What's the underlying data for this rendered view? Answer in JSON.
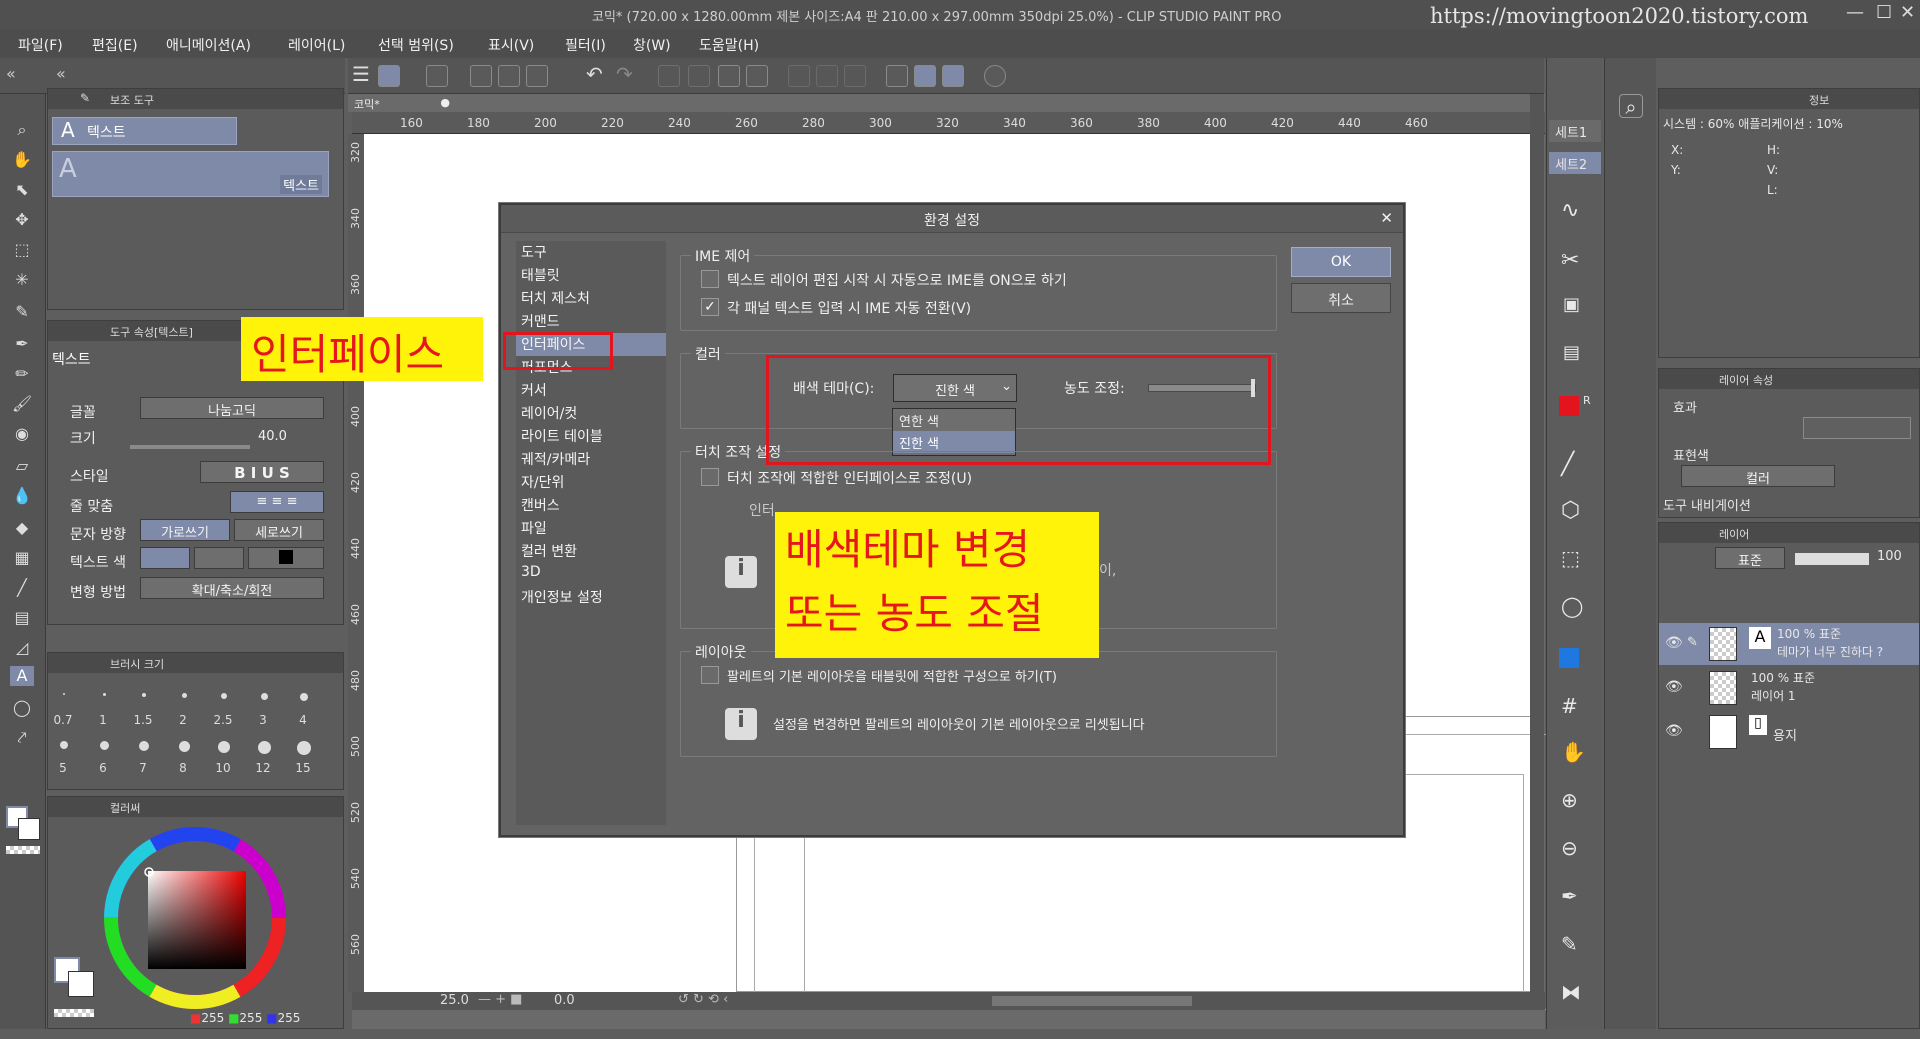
{
  "titlebar": {
    "text": "코믹* (720.00 x 1280.00mm 제본 사이즈:A4 판 210.00 x 297.00mm 350dpi 25.0%)  - CLIP STUDIO PAINT PRO",
    "url": "https://movingtoon2020.tistory.com",
    "minimize": "—",
    "maximize": "☐",
    "close": "✕"
  },
  "menu": [
    "파일(F)",
    "편집(E)",
    "애니메이션(A)",
    "레이어(L)",
    "선택 범위(S)",
    "표시(V)",
    "필터(I)",
    "창(W)",
    "도움말(H)"
  ],
  "sub_tool": {
    "title": "보조 도구",
    "item": "텍스트",
    "preview_label": "텍스트"
  },
  "tool_props": {
    "title": "도구 속성[텍스트]",
    "name": "텍스트",
    "rows": [
      {
        "label": "글꼴",
        "value": "나눔고딕"
      },
      {
        "label": "크기",
        "value": "40.0"
      },
      {
        "label": "스타일",
        "value": "B I U S"
      },
      {
        "label": "줄 맞춤",
        "value": "≡ ≡ ≡"
      },
      {
        "label": "문자 방향",
        "value": "가로쓰기",
        "value2": "세로쓰기"
      },
      {
        "label": "텍스트 색",
        "value": ""
      },
      {
        "label": "변형 방법",
        "value": "확대/축소/회전"
      }
    ]
  },
  "brush_size": {
    "title": "브러시 크기",
    "row1": [
      "0.7",
      "1",
      "1.5",
      "2",
      "2.5",
      "3",
      "4"
    ],
    "row2": [
      "5",
      "6",
      "7",
      "8",
      "10",
      "12",
      "15"
    ]
  },
  "color_wheel": {
    "title": "컬러써",
    "rgb": {
      "r": "255",
      "g": "255",
      "b": "255"
    }
  },
  "canvas": {
    "tab": "코믹*",
    "zoom": "25.0",
    "angle": "0.0",
    "ruler_h": [
      "160",
      "180",
      "200",
      "220",
      "240",
      "260",
      "280",
      "300",
      "320",
      "340",
      "360",
      "380",
      "400",
      "420",
      "440",
      "460"
    ],
    "ruler_v": [
      "320",
      "340",
      "360",
      "380",
      "400",
      "420",
      "440",
      "460",
      "480",
      "500",
      "520",
      "540",
      "560"
    ]
  },
  "dialog": {
    "title": "환경 설정",
    "close": "✕",
    "categories": [
      "도구",
      "태블릿",
      "터치 제스처",
      "커맨드",
      "인터페이스",
      "퍼포먼스",
      "커서",
      "레이어/컷",
      "라이트 테이블",
      "궤적/카메라",
      "자/단위",
      "캔버스",
      "파일",
      "컬러 변환",
      "3D",
      "개인정보 설정"
    ],
    "selected_category": "인터페이스",
    "ime": {
      "label": "IME 제어",
      "opt1": "텍스트 레이어 편집 시작 시 자동으로 IME를 ON으로 하기",
      "opt2": "각 패널 텍스트 입력 시 IME 자동 전환(V)",
      "opt1_checked": false,
      "opt2_checked": true
    },
    "color": {
      "label": "컬러",
      "theme_label": "배색 테마(C):",
      "theme_value": "진한 색",
      "options": [
        "연한 색",
        "진한 색"
      ],
      "density_label": "농도 조정:",
      "density": 1.0
    },
    "touch": {
      "label": "터치 조작 설정",
      "opt": "터치 조작에 적합한 인터페이스로 조정(U)",
      "info_fragment": "인터",
      "info_tail": "이,"
    },
    "layout": {
      "label": "레이아웃",
      "opt": "팔레트의 기본 레이아웃을 태블릿에 적합한 구성으로 하기(T)",
      "info": "설정을 변경하면 팔레트의 레이아웃이 기본 레이아웃으로 리셋됩니다"
    },
    "ok": "OK",
    "cancel": "취소"
  },
  "annotations": {
    "interface": "인터페이스",
    "theme_line1": "배색테마 변경",
    "theme_line2": "또는 농도 조절"
  },
  "sets": [
    "세트1",
    "세트2"
  ],
  "info": {
    "title": "정보",
    "system": "시스템 : 60% 애플리케이션 : 10%",
    "x": "X:",
    "y": "Y:",
    "h": "H:",
    "v": "V:",
    "l": "L:"
  },
  "layer_prop": {
    "title": "레이어 속성",
    "effect": "효과",
    "express": "표현색",
    "express_value": "컬러",
    "navigator": "도구 내비게이션"
  },
  "layers": {
    "title": "레이어",
    "blend": "표준",
    "opacity": "100",
    "items": [
      {
        "meta": "100 % 표준",
        "name": "테마가 너무 진하다 ?"
      },
      {
        "meta": "100 % 표준",
        "name": "레이어 1"
      },
      {
        "meta": "",
        "name": "용지"
      }
    ]
  },
  "colors": {
    "accent": "#7e8aa8",
    "red": "#e3141e",
    "yellow": "#fff30a"
  }
}
